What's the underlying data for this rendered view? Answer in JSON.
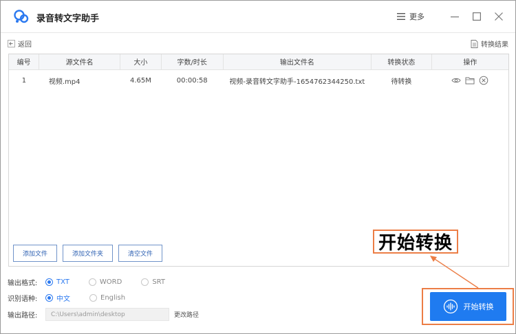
{
  "app": {
    "title": "录音转文字助手",
    "menu_label": "更多"
  },
  "toolbar": {
    "back_label": "返回",
    "results_label": "转换结果"
  },
  "table": {
    "headers": [
      "编号",
      "源文件名",
      "大小",
      "字数/时长",
      "输出文件名",
      "转换状态",
      "操作"
    ],
    "rows": [
      {
        "index": "1",
        "source": "视频.mp4",
        "size": "4.65M",
        "duration": "00:00:58",
        "output": "视频-录音转文字助手-1654762344250.txt",
        "status": "待转换"
      }
    ]
  },
  "panel_buttons": {
    "add_file": "添加文件",
    "add_folder": "添加文件夹",
    "clear": "清空文件"
  },
  "options": {
    "format_label": "输出格式:",
    "formats": [
      "TXT",
      "WORD",
      "SRT"
    ],
    "selected_format": "TXT",
    "language_label": "识别语种:",
    "languages": [
      "中文",
      "English"
    ],
    "selected_language": "中文",
    "path_label": "输出路径:",
    "path_value": "C:\\Users\\admin\\desktop",
    "change_path_label": "更改路径"
  },
  "start_button_label": "开始转换",
  "annotation_label": "开始转换",
  "colors": {
    "accent": "#1f7bf0",
    "annotation": "#ec7d45"
  }
}
